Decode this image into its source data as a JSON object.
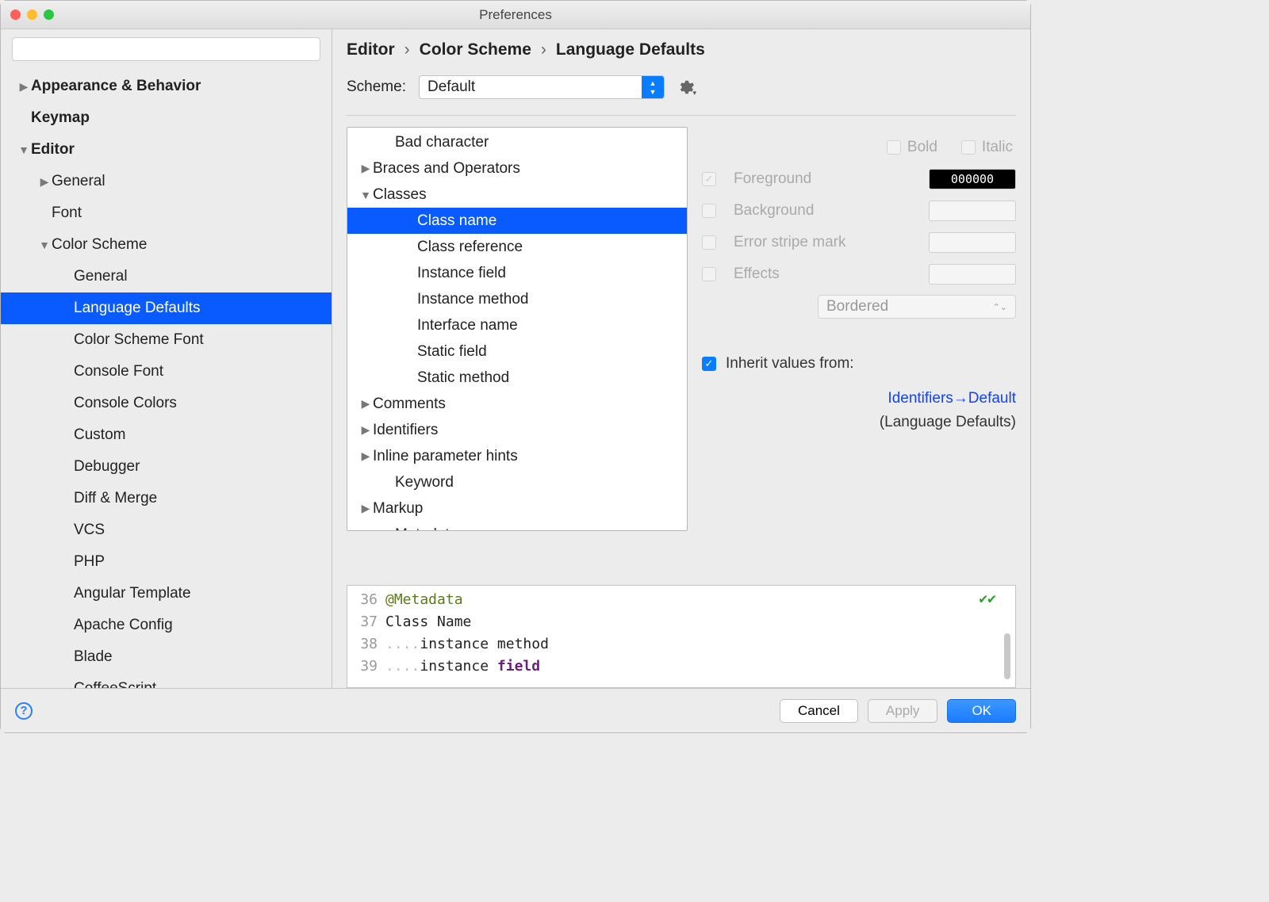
{
  "window": {
    "title": "Preferences"
  },
  "sidebar": {
    "search_placeholder": "",
    "items": [
      {
        "label": "Appearance & Behavior",
        "bold": true,
        "arrow": "right",
        "indent": 0
      },
      {
        "label": "Keymap",
        "bold": true,
        "arrow": "",
        "indent": 0
      },
      {
        "label": "Editor",
        "bold": true,
        "arrow": "down",
        "indent": 0
      },
      {
        "label": "General",
        "arrow": "right",
        "indent": 1
      },
      {
        "label": "Font",
        "arrow": "",
        "indent": 1
      },
      {
        "label": "Color Scheme",
        "arrow": "down",
        "indent": 1
      },
      {
        "label": "General",
        "arrow": "",
        "indent": 2
      },
      {
        "label": "Language Defaults",
        "arrow": "",
        "indent": 2,
        "selected": true
      },
      {
        "label": "Color Scheme Font",
        "arrow": "",
        "indent": 2
      },
      {
        "label": "Console Font",
        "arrow": "",
        "indent": 2
      },
      {
        "label": "Console Colors",
        "arrow": "",
        "indent": 2
      },
      {
        "label": "Custom",
        "arrow": "",
        "indent": 2
      },
      {
        "label": "Debugger",
        "arrow": "",
        "indent": 2
      },
      {
        "label": "Diff & Merge",
        "arrow": "",
        "indent": 2
      },
      {
        "label": "VCS",
        "arrow": "",
        "indent": 2
      },
      {
        "label": "PHP",
        "arrow": "",
        "indent": 2
      },
      {
        "label": "Angular Template",
        "arrow": "",
        "indent": 2
      },
      {
        "label": "Apache Config",
        "arrow": "",
        "indent": 2
      },
      {
        "label": "Blade",
        "arrow": "",
        "indent": 2
      },
      {
        "label": "CoffeeScript",
        "arrow": "",
        "indent": 2
      }
    ]
  },
  "breadcrumb": {
    "a": "Editor",
    "b": "Color Scheme",
    "c": "Language Defaults"
  },
  "scheme": {
    "label": "Scheme:",
    "value": "Default"
  },
  "tree": [
    {
      "label": "Bad character",
      "arrow": "",
      "indent": 1
    },
    {
      "label": "Braces and Operators",
      "arrow": "right",
      "indent": 0
    },
    {
      "label": "Classes",
      "arrow": "down",
      "indent": 0
    },
    {
      "label": "Class name",
      "arrow": "",
      "indent": 2,
      "selected": true
    },
    {
      "label": "Class reference",
      "arrow": "",
      "indent": 2
    },
    {
      "label": "Instance field",
      "arrow": "",
      "indent": 2
    },
    {
      "label": "Instance method",
      "arrow": "",
      "indent": 2
    },
    {
      "label": "Interface name",
      "arrow": "",
      "indent": 2
    },
    {
      "label": "Static field",
      "arrow": "",
      "indent": 2
    },
    {
      "label": "Static method",
      "arrow": "",
      "indent": 2
    },
    {
      "label": "Comments",
      "arrow": "right",
      "indent": 0
    },
    {
      "label": "Identifiers",
      "arrow": "right",
      "indent": 0
    },
    {
      "label": "Inline parameter hints",
      "arrow": "right",
      "indent": 0
    },
    {
      "label": "Keyword",
      "arrow": "",
      "indent": 1
    },
    {
      "label": "Markup",
      "arrow": "right",
      "indent": 0
    },
    {
      "label": "Metadata",
      "arrow": "",
      "indent": 1
    }
  ],
  "props": {
    "bold": "Bold",
    "italic": "Italic",
    "foreground": "Foreground",
    "foreground_value": "000000",
    "background": "Background",
    "error_stripe": "Error stripe mark",
    "effects": "Effects",
    "effects_value": "Bordered",
    "inherit": "Inherit values from:",
    "inherit_link": "Identifiers→Default",
    "inherit_sub": "(Language Defaults)"
  },
  "preview": {
    "lines": [
      "36",
      "37",
      "38",
      "39"
    ],
    "l1_meta": "@Metadata",
    "l2": "Class Name",
    "l3a": "....",
    "l3b": "instance method",
    "l4a": "....",
    "l4b": "instance ",
    "l4c": "field"
  },
  "footer": {
    "cancel": "Cancel",
    "apply": "Apply",
    "ok": "OK"
  }
}
